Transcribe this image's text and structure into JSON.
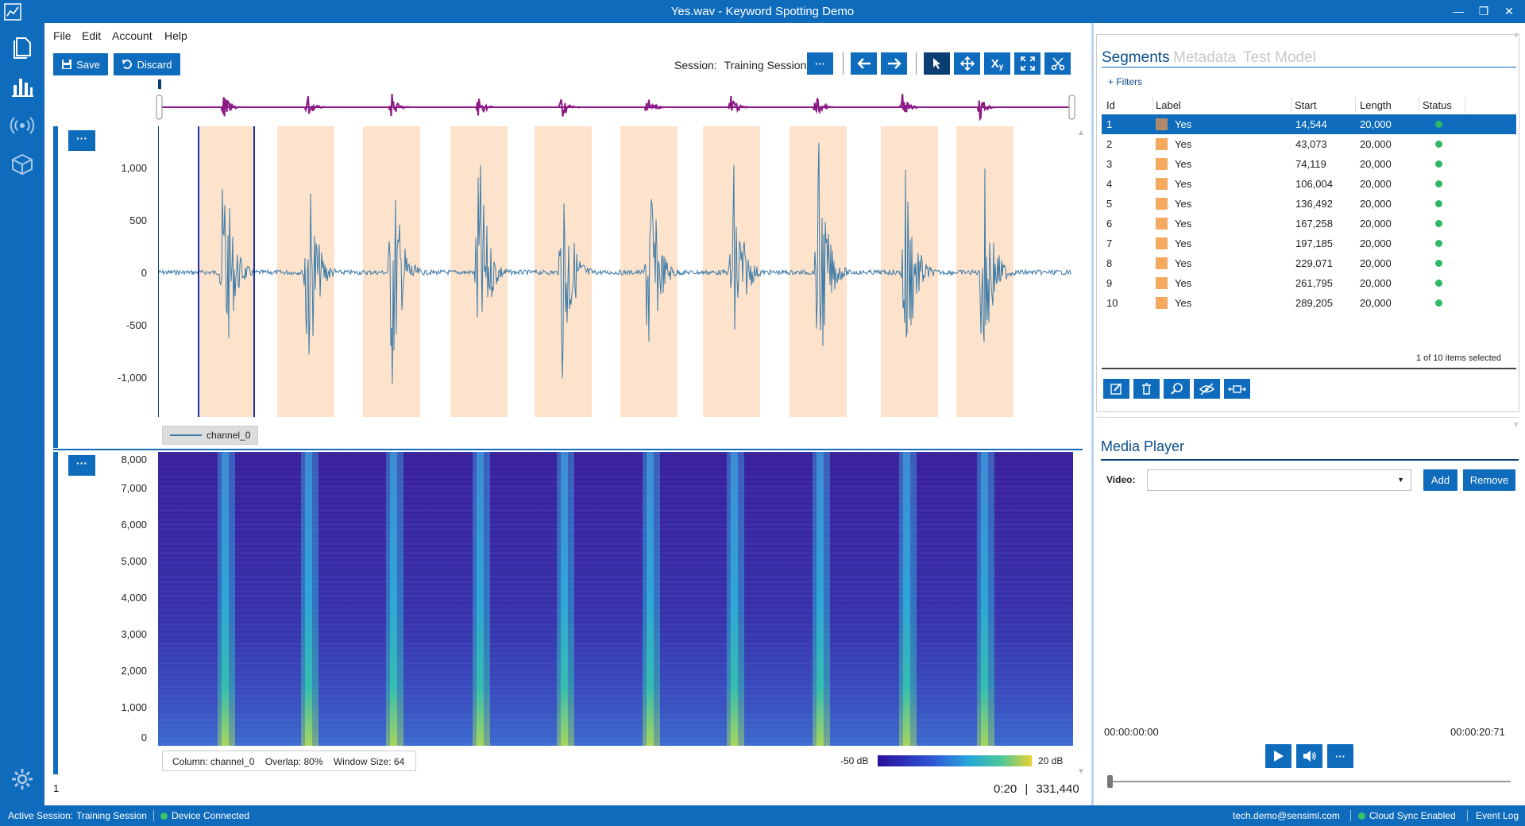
{
  "window": {
    "title": "Yes.wav - Keyword Spotting Demo"
  },
  "menu": [
    "File",
    "Edit",
    "Account",
    "Help"
  ],
  "toolbar": {
    "save_label": "Save",
    "discard_label": "Discard",
    "session_label": "Session:",
    "session_value": "Training Session",
    "more_label": "···",
    "xy_label": "X",
    "xy_sub": "y"
  },
  "waveform": {
    "y_ticks": [
      "1,000",
      "500",
      "0",
      "-500",
      "-1,000"
    ],
    "legend": "channel_0",
    "more_label": "···",
    "color": "#3c7aa8",
    "segment_color": "#fde3cc"
  },
  "spectrogram": {
    "y_ticks": [
      "8,000",
      "7,000",
      "6,000",
      "5,000",
      "4,000",
      "3,000",
      "2,000",
      "1,000",
      "0"
    ],
    "more_label": "···",
    "column_label": "Column:",
    "column_value": "channel_0",
    "overlap_label": "Overlap:",
    "overlap_value": "80%",
    "window_label": "Window Size:",
    "window_value": "64",
    "scale_min": "-50 dB",
    "scale_max": "20 dB"
  },
  "footer": {
    "page": "1",
    "time": "0:20",
    "separator": "|",
    "samples": "331,440"
  },
  "segments_panel": {
    "tabs": [
      "Segments",
      "Metadata",
      "Test Model"
    ],
    "filters_label": "+ Filters",
    "columns": [
      "Id",
      "Label",
      "Start",
      "Length",
      "Status"
    ],
    "rows": [
      {
        "id": "1",
        "label": "Yes",
        "start": "14,544",
        "length": "20,000"
      },
      {
        "id": "2",
        "label": "Yes",
        "start": "43,073",
        "length": "20,000"
      },
      {
        "id": "3",
        "label": "Yes",
        "start": "74,119",
        "length": "20,000"
      },
      {
        "id": "4",
        "label": "Yes",
        "start": "106,004",
        "length": "20,000"
      },
      {
        "id": "5",
        "label": "Yes",
        "start": "136,492",
        "length": "20,000"
      },
      {
        "id": "6",
        "label": "Yes",
        "start": "167,258",
        "length": "20,000"
      },
      {
        "id": "7",
        "label": "Yes",
        "start": "197,185",
        "length": "20,000"
      },
      {
        "id": "8",
        "label": "Yes",
        "start": "229,071",
        "length": "20,000"
      },
      {
        "id": "9",
        "label": "Yes",
        "start": "261,795",
        "length": "20,000"
      },
      {
        "id": "10",
        "label": "Yes",
        "start": "289,205",
        "length": "20,000"
      }
    ],
    "selection_status": "1 of 10 items selected"
  },
  "media_player": {
    "title": "Media Player",
    "video_label": "Video:",
    "add_label": "Add",
    "remove_label": "Remove",
    "time_start": "00:00:00:00",
    "time_end": "00:00:20:71",
    "more_label": "···"
  },
  "status": {
    "active_session_label": "Active Session:",
    "active_session_value": "Training Session",
    "device": "Device Connected",
    "user": "tech.demo@sensiml.com",
    "cloud": "Cloud Sync Enabled",
    "event_log": "Event Log"
  },
  "colors": {
    "accent": "#0f6cbd",
    "status_green": "#2fb866",
    "overview_wave": "#8b1a86"
  }
}
